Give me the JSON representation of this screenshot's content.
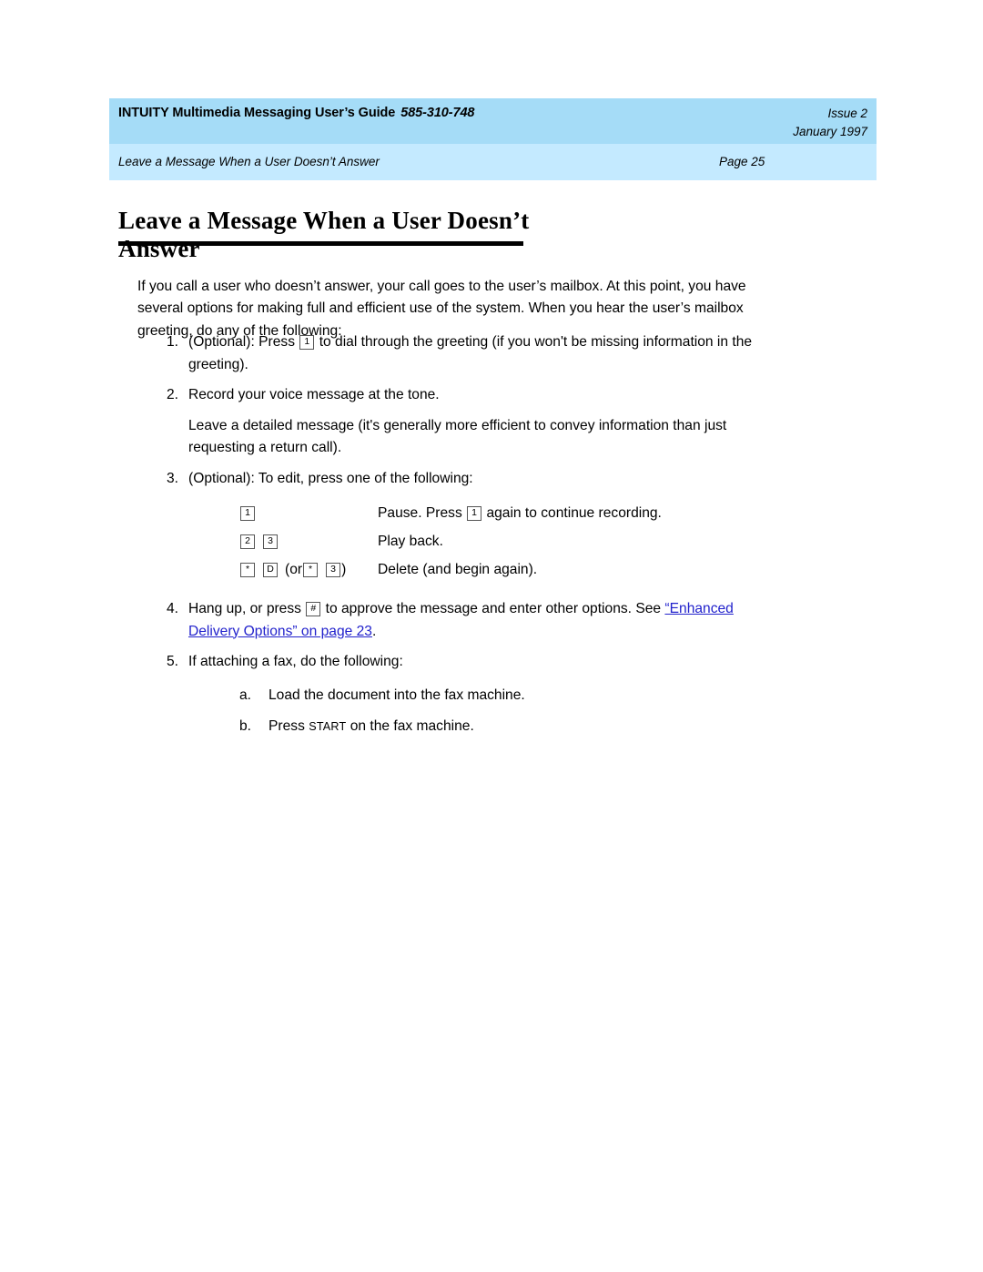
{
  "header": {
    "guide_title": "INTUITY Multimedia Messaging User’s Guide",
    "doc_number": "585-310-748",
    "issue": "Issue 2",
    "date": "January 1997",
    "chapter": "Leave a Message When a User Doesn’t Answer",
    "page_label": "Page 25"
  },
  "section": {
    "title": "Leave a Message When a User Doesn’t Answer"
  },
  "body": {
    "intro": "If you call a user who doesn’t answer, your call goes to the user’s mailbox. At this point, you have several options for making full and efficient use of the system. When you hear the user’s mailbox greeting, do any of the following:"
  },
  "steps": {
    "s1_marker": "1.",
    "s1_a": "(Optional): Press",
    "s1_key": "1",
    "s1_b": "to dial through the greeting (if you won't be missing information in the greeting).",
    "s2_marker": "2.",
    "s2_text": "Record your voice message at the tone.",
    "s2_cont": "Leave a detailed message (it's generally more efficient to convey information than just requesting a return call).",
    "s3_marker": "3.",
    "s3_text": "(Optional): To edit, press one of the following:",
    "s4_marker": "4.",
    "s4_a": "Hang up, or press",
    "s4_key": "#",
    "s4_b": "to approve the message and enter other options. See",
    "s4_xref": "“Enhanced Delivery Options” on page 23",
    "s4_end": ".",
    "s5_marker": "5.",
    "s5_text": "If attaching a fax, do the following:",
    "s5a_marker": "a.",
    "s5a_text": "Load the document into the fax machine.",
    "s5b_marker": "b.",
    "s5b_a": "Press",
    "s5b_key": "START",
    "s5b_b": "on the fax machine."
  },
  "keys_table": {
    "row1": {
      "key1": "1",
      "desc_a": "Pause. Press",
      "desc_key": "1",
      "desc_b": "again to continue recording."
    },
    "row2": {
      "key1": "2",
      "key2": "3",
      "desc": "Play back."
    },
    "row3": {
      "key1": "*",
      "key2": "D",
      "or_open": "(or",
      "key3": "*",
      "key4": "3",
      "or_close": ")",
      "desc": "Delete (and begin again)."
    }
  },
  "colors": {
    "band_top": "#a5dcf7",
    "band_bottom": "#c4eaff",
    "xref_blue": "#2222cc",
    "rule_black": "#000000"
  }
}
